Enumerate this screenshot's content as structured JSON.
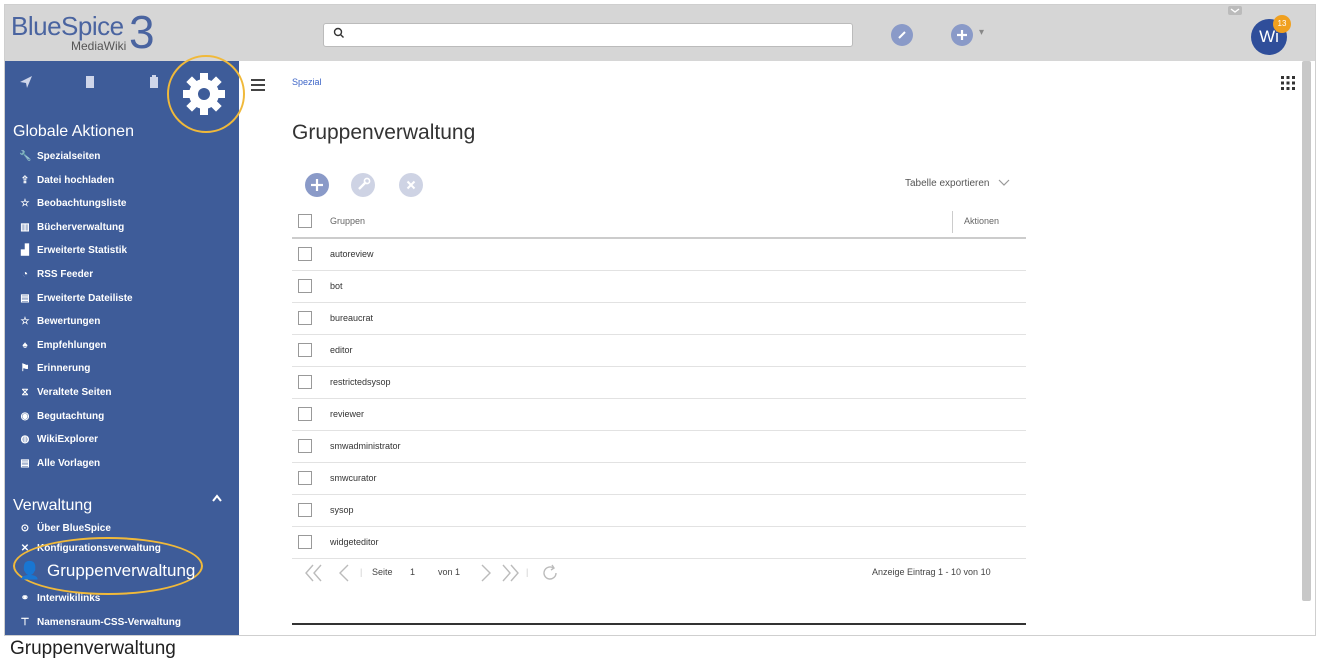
{
  "logo": {
    "line1": "BlueSpice",
    "line2": "MediaWiki",
    "mark": "3"
  },
  "search": {
    "placeholder": ""
  },
  "user": {
    "initials": "Wi",
    "notifications": "13"
  },
  "sidebar": {
    "section1": "Globale Aktionen",
    "items": [
      {
        "label": "Spezialseiten",
        "icon": "wrench-icon"
      },
      {
        "label": "Datei hochladen",
        "icon": "upload-icon"
      },
      {
        "label": "Beobachtungsliste",
        "icon": "star-icon"
      },
      {
        "label": "Bücherverwaltung",
        "icon": "books-icon"
      },
      {
        "label": "Erweiterte Statistik",
        "icon": "stats-icon"
      },
      {
        "label": "RSS Feeder",
        "icon": "rss-icon"
      },
      {
        "label": "Erweiterte Dateiliste",
        "icon": "list-icon"
      },
      {
        "label": "Bewertungen",
        "icon": "star-icon"
      },
      {
        "label": "Empfehlungen",
        "icon": "flame-icon"
      },
      {
        "label": "Erinnerung",
        "icon": "flag-icon"
      },
      {
        "label": "Veraltete Seiten",
        "icon": "hourglass-icon"
      },
      {
        "label": "Begutachtung",
        "icon": "eye-icon"
      },
      {
        "label": "WikiExplorer",
        "icon": "globe-icon"
      },
      {
        "label": "Alle Vorlagen",
        "icon": "template-icon"
      }
    ],
    "section2": "Verwaltung",
    "admin_items": [
      {
        "label": "Über BlueSpice",
        "icon": "info-icon"
      },
      {
        "label": "Konfigurationsverwaltung",
        "icon": "config-icon"
      },
      {
        "label": "Interwikilinks",
        "icon": "link-icon"
      },
      {
        "label": "Namensraum-CSS-Verwaltung",
        "icon": "brush-icon"
      }
    ],
    "highlight": "Gruppenverwaltung"
  },
  "main": {
    "breadcrumb": "Spezial",
    "title": "Gruppenverwaltung",
    "export_label": "Tabelle exportieren",
    "col_groups": "Gruppen",
    "col_actions": "Aktionen",
    "rows": [
      "autoreview",
      "bot",
      "bureaucrat",
      "editor",
      "restrictedsysop",
      "reviewer",
      "smwadministrator",
      "smwcurator",
      "sysop",
      "widgeteditor"
    ]
  },
  "pager": {
    "page_label": "Seite",
    "page": "1",
    "of_label": "von 1",
    "summary": "Anzeige Eintrag 1 - 10 von 10"
  },
  "caption": "Gruppenverwaltung",
  "colors": {
    "sidebar": "#3e5c99",
    "highlight": "#f0b93a",
    "accent": "#8a9ac8"
  }
}
